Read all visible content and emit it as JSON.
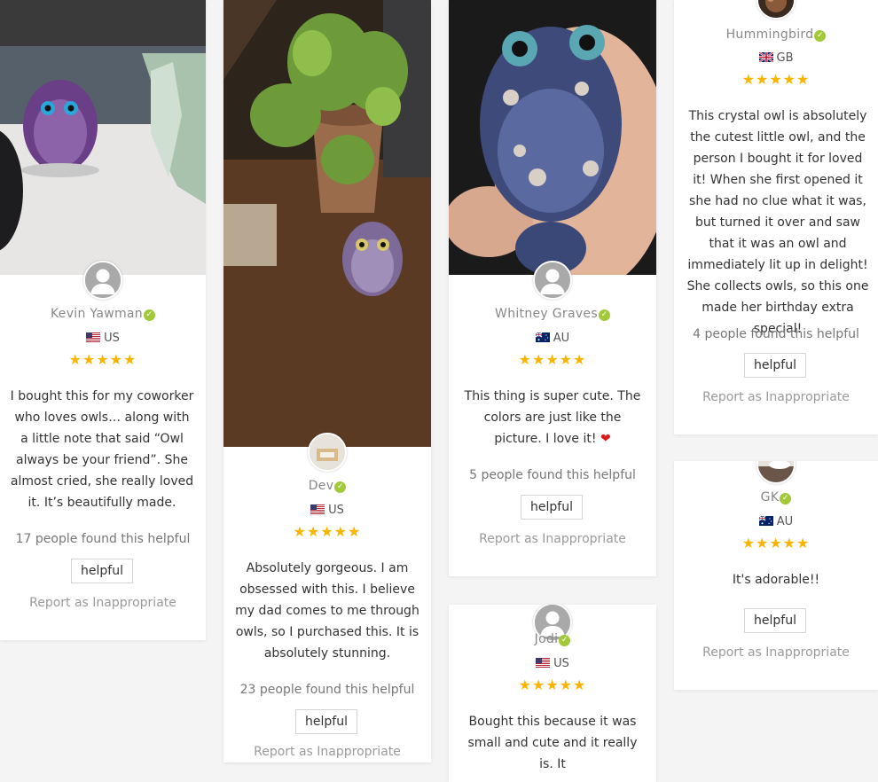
{
  "verified_mark": "✓",
  "stars": "★★★★★",
  "helpful_button_label": "helpful",
  "report_label": "Report as Inappropriate",
  "reviews": [
    {
      "name": "Kevin Yawman",
      "country": "US",
      "flag": "us-flag",
      "rating": 5,
      "text": "I bought this for my coworker who loves owls… along with a little note that said “Owl always be your friend”. She almost cried, she really loved it. It’s beautifully made.",
      "helpful_count": "17 people found this helpful"
    },
    {
      "name": "Dev",
      "country": "US",
      "flag": "us-flag",
      "rating": 5,
      "text": "Absolutely gorgeous. I am obsessed with this. I believe my dad comes to me through owls, so I purchased this. It is absolutely stunning.",
      "helpful_count": "23 people found this helpful"
    },
    {
      "name": "Whitney Graves",
      "country": "AU",
      "flag": "au-flag",
      "rating": 5,
      "text": "This thing is super cute. The colors are just like the picture. I love it!",
      "text_emoji": "❤",
      "helpful_count": "5 people found this helpful"
    },
    {
      "name": "Jodi",
      "country": "US",
      "flag": "us-flag",
      "rating": 5,
      "text": "Bought this because it was small and cute and it really is. It"
    },
    {
      "name": "Hummingbird",
      "country": "GB",
      "flag": "gb-flag",
      "rating": 5,
      "text": "This crystal owl is absolutely the cutest little owl, and the person I bought it for loved it! When she first opened it she had no clue what it was, but turned it over and saw that it was an owl and immediately lit up in delight! She collects owls, so this one made her birthday extra special!",
      "helpful_count": "4 people found this helpful"
    },
    {
      "name": "GK",
      "country": "AU",
      "flag": "au-flag",
      "rating": 5,
      "text": "It's adorable!!",
      "helpful_count": ""
    }
  ],
  "colors": {
    "star": "#f7b500",
    "verified": "#a2c93a",
    "heart": "#d81b1b"
  }
}
